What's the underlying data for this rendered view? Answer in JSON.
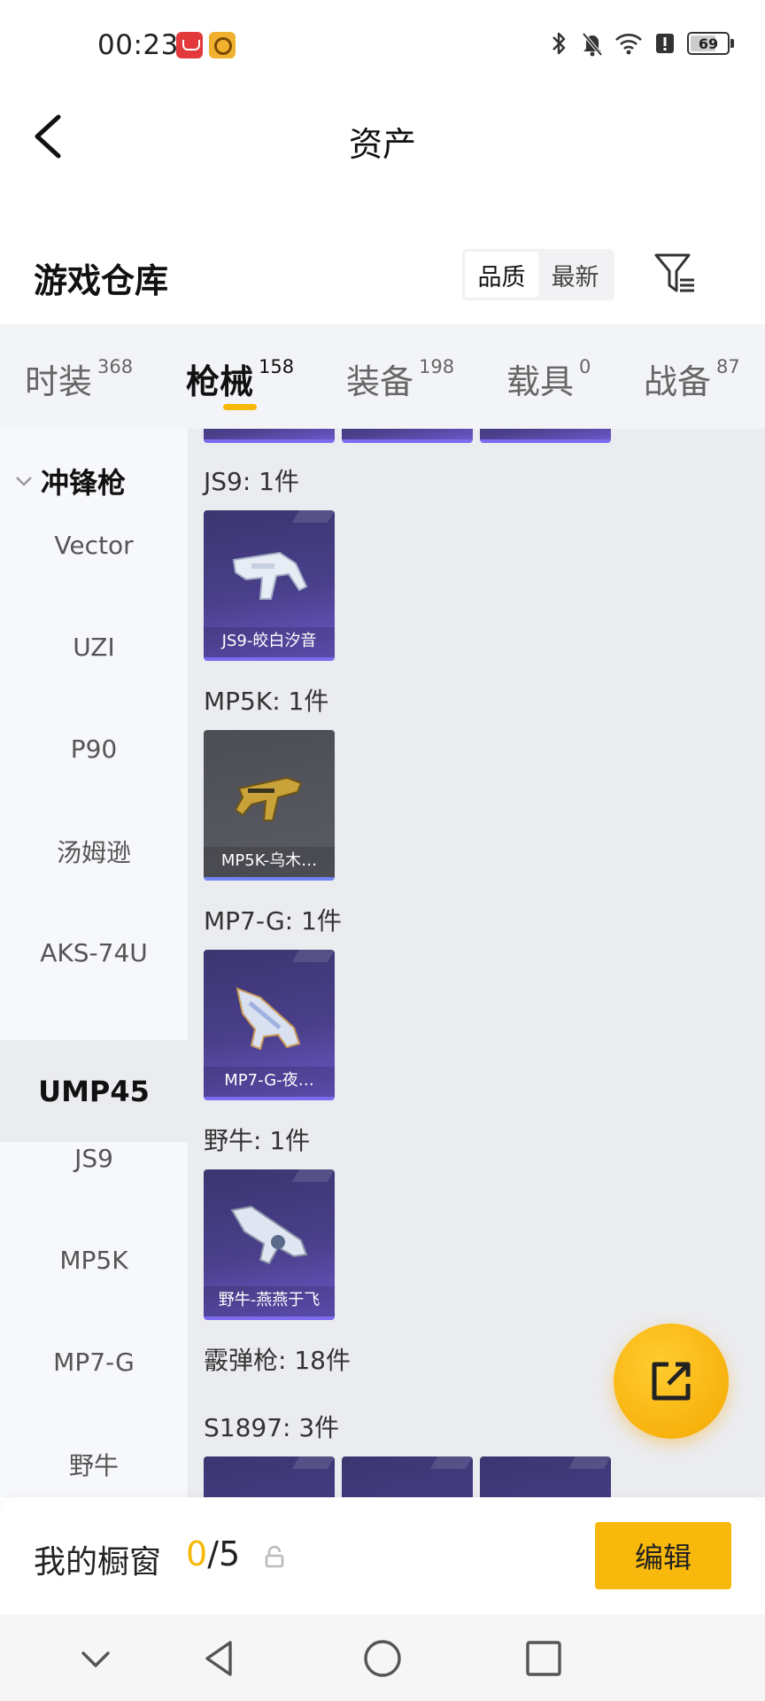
{
  "status": {
    "time": "00:23",
    "battery": "69"
  },
  "header": {
    "title": "资产"
  },
  "warehouse": {
    "title": "游戏仓库",
    "sort_options": [
      "品质",
      "最新"
    ]
  },
  "tabs": [
    {
      "label": "时装",
      "count": "368"
    },
    {
      "label": "枪械",
      "count": "158"
    },
    {
      "label": "装备",
      "count": "198"
    },
    {
      "label": "载具",
      "count": "0"
    },
    {
      "label": "战备",
      "count": "87"
    }
  ],
  "sidebar": {
    "category": "冲锋枪",
    "items": [
      "Vector",
      "UZI",
      "P90",
      "汤姆逊",
      "AKS-74U",
      "UMP45",
      "JS9",
      "MP5K",
      "MP7-G",
      "野牛"
    ]
  },
  "groups": [
    {
      "title": "JS9: 1件",
      "cards": [
        {
          "name": "JS9-皎白汐音"
        }
      ]
    },
    {
      "title": "MP5K: 1件",
      "cards": [
        {
          "name": "MP5K-乌木…"
        }
      ]
    },
    {
      "title": "MP7-G: 1件",
      "cards": [
        {
          "name": "MP7-G-夜…"
        }
      ]
    },
    {
      "title": "野牛: 1件",
      "cards": [
        {
          "name": "野牛-燕燕于飞"
        }
      ]
    },
    {
      "title": "霰弹枪: 18件"
    },
    {
      "title": "S1897: 3件"
    }
  ],
  "showcase": {
    "label": "我的橱窗",
    "current": "0",
    "total": "/5",
    "edit_label": "编辑"
  },
  "colors": {
    "accent": "#f6b90a",
    "card_purple": "#4a3f8a",
    "card_grey": "#55565e"
  }
}
